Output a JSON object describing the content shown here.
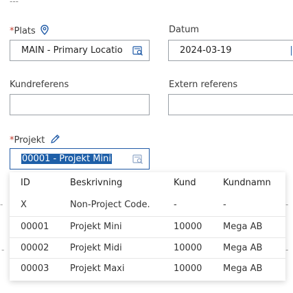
{
  "top_marker": "---",
  "plats": {
    "required_mark": "*",
    "label": "Plats",
    "value": "MAIN - Primary Locatio"
  },
  "datum": {
    "label": "Datum",
    "value": "2024-03-19"
  },
  "kundreferens": {
    "label": "Kundreferens",
    "value": ""
  },
  "extern_referens": {
    "label": "Extern referens",
    "value": ""
  },
  "projekt": {
    "required_mark": "*",
    "label": "Projekt",
    "value": "00001 - Projekt Mini"
  },
  "dropdown": {
    "headers": {
      "id": "ID",
      "beskrivning": "Beskrivning",
      "kund": "Kund",
      "kundnamn": "Kundnamn"
    },
    "rows": [
      {
        "id": "X",
        "beskrivning": "Non-Project Code.",
        "kund": "-",
        "kundnamn": "-"
      },
      {
        "id": "00001",
        "beskrivning": "Projekt Mini",
        "kund": "10000",
        "kundnamn": "Mega AB"
      },
      {
        "id": "00002",
        "beskrivning": "Projekt Midi",
        "kund": "10000",
        "kundnamn": "Mega AB"
      },
      {
        "id": "00003",
        "beskrivning": "Projekt Maxi",
        "kund": "10000",
        "kundnamn": "Mega AB"
      }
    ]
  },
  "side_dash": "-",
  "icons": {
    "plats": "location-pin-icon",
    "projekt": "pencil-icon",
    "lookup": "lookup-search-icon"
  },
  "colors": {
    "accent": "#1f5aa6",
    "required": "#c0392b",
    "selection": "#1e5fa8"
  }
}
